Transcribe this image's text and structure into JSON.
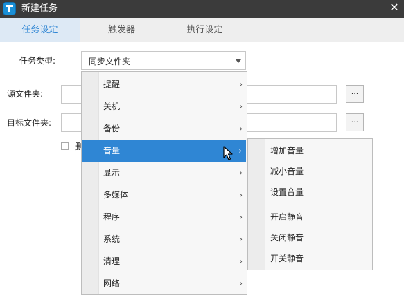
{
  "window": {
    "title": "新建任务",
    "close_glyph": "✕"
  },
  "tabs": [
    {
      "label": "任务设定",
      "active": true
    },
    {
      "label": "触发器",
      "active": false
    },
    {
      "label": "执行设定",
      "active": false
    }
  ],
  "form": {
    "task_type_label": "任务类型:",
    "task_type_value": "同步文件夹",
    "source_label": "源文件夹:",
    "target_label": "目标文件夹:",
    "browse_label": "...",
    "checkbox_label_partial": "删"
  },
  "menu": {
    "items": [
      {
        "label": "提醒",
        "arrow": "›"
      },
      {
        "label": "关机",
        "arrow": "›"
      },
      {
        "label": "备份",
        "arrow": "›"
      },
      {
        "label": "音量",
        "arrow": "›",
        "highlighted": true
      },
      {
        "label": "显示",
        "arrow": "›"
      },
      {
        "label": "多媒体",
        "arrow": "›"
      },
      {
        "label": "程序",
        "arrow": "›"
      },
      {
        "label": "系统",
        "arrow": "›"
      },
      {
        "label": "清理",
        "arrow": "›"
      },
      {
        "label": "网络",
        "arrow": "›"
      }
    ]
  },
  "submenu": {
    "items": [
      {
        "label": "增加音量"
      },
      {
        "label": "减小音量"
      },
      {
        "label": "设置音量"
      },
      {
        "label": "开启静音"
      },
      {
        "label": "关闭静音"
      },
      {
        "label": "开关静音"
      }
    ]
  },
  "colors": {
    "accent": "#2f86d4",
    "titlebar": "#3b3b3b",
    "active_tab_bg": "#dde9f5"
  },
  "icons": {
    "app": "app-logo-icon",
    "cursor": "mouse-pointer-icon"
  }
}
